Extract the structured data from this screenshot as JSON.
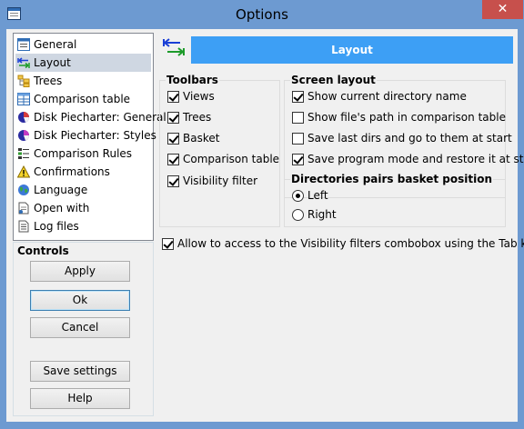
{
  "window": {
    "title": "Options",
    "close_glyph": "✕"
  },
  "nav": {
    "selected_index": 1,
    "items": [
      {
        "label": "General",
        "icon": "form-icon"
      },
      {
        "label": "Layout",
        "icon": "layout-arrows-icon"
      },
      {
        "label": "Trees",
        "icon": "tree-icon"
      },
      {
        "label": "Comparison table",
        "icon": "table-icon"
      },
      {
        "label": "Disk Piecharter: General",
        "icon": "pie-chart-icon"
      },
      {
        "label": "Disk Piecharter: Styles",
        "icon": "pie-chart-styles-icon"
      },
      {
        "label": "Comparison Rules",
        "icon": "rules-icon"
      },
      {
        "label": "Confirmations",
        "icon": "warning-icon"
      },
      {
        "label": "Language",
        "icon": "globe-icon"
      },
      {
        "label": "Open with",
        "icon": "open-document-icon"
      },
      {
        "label": "Log files",
        "icon": "log-file-icon"
      }
    ]
  },
  "controls": {
    "label": "Controls",
    "apply": "Apply",
    "ok": "Ok",
    "cancel": "Cancel",
    "save_settings": "Save settings",
    "help": "Help"
  },
  "page": {
    "header": "Layout",
    "accent": "#3d9ff5"
  },
  "toolbars": {
    "label": "Toolbars",
    "items": [
      {
        "label": "Views",
        "checked": true
      },
      {
        "label": "Trees",
        "checked": true
      },
      {
        "label": "Basket",
        "checked": true
      },
      {
        "label": "Comparison table",
        "checked": true
      },
      {
        "label": "Visibility filter",
        "checked": true
      }
    ]
  },
  "screen_layout": {
    "label": "Screen layout",
    "items": [
      {
        "label": "Show current directory name",
        "checked": true
      },
      {
        "label": "Show file's path in comparison table",
        "checked": false
      },
      {
        "label": "Save last dirs and go to them at start",
        "checked": false
      },
      {
        "label": "Save program mode and restore it at star",
        "checked": true
      }
    ]
  },
  "basket_position": {
    "label": "Directories pairs basket position",
    "options": [
      {
        "label": "Left",
        "selected": true
      },
      {
        "label": "Right",
        "selected": false
      }
    ]
  },
  "tab_key_option": {
    "label": "Allow to access to the Visibility filters combobox using the Tab key",
    "checked": true
  }
}
